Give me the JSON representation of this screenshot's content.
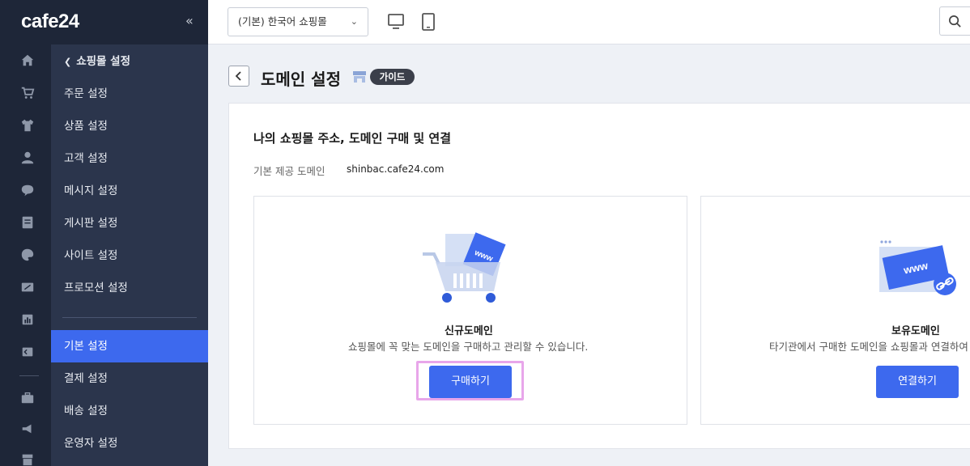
{
  "app": {
    "logo": "cafe24",
    "collapse_symbol": "«"
  },
  "rail_icons": [
    "home-icon",
    "cart-icon",
    "shirt-icon",
    "user-icon",
    "chat-icon",
    "board-icon",
    "palette-icon",
    "percent-icon",
    "stats-icon",
    "app-icon",
    "briefcase-icon",
    "megaphone-icon",
    "store-icon"
  ],
  "sidebar": {
    "back_label": "쇼핑몰 설정",
    "items": [
      {
        "label": "주문 설정"
      },
      {
        "label": "상품 설정"
      },
      {
        "label": "고객 설정"
      },
      {
        "label": "메시지 설정"
      },
      {
        "label": "게시판 설정"
      },
      {
        "label": "사이트 설정"
      },
      {
        "label": "프로모션 설정"
      }
    ],
    "items2": [
      {
        "label": "기본 설정",
        "active": true
      },
      {
        "label": "결제 설정"
      },
      {
        "label": "배송 설정"
      },
      {
        "label": "운영자 설정"
      }
    ]
  },
  "topbar": {
    "shop_select_value": "(기본) 한국어 쇼핑몰",
    "view_icons": [
      "desktop-icon",
      "mobile-icon"
    ]
  },
  "page": {
    "title": "도메인 설정",
    "guide_label": "가이드"
  },
  "content": {
    "section_title": "나의 쇼핑몰 주소, 도메인 구매 및 연결",
    "default_domain_label": "기본 제공 도메인",
    "default_domain_value": "shinbac.cafe24.com",
    "new_domain": {
      "illustration_text": "www",
      "title": "신규도메인",
      "desc": "쇼핑몰에 꼭 맞는 도메인을 구매하고 관리할 수 있습니다.",
      "button": "구매하기"
    },
    "own_domain": {
      "illustration_text": "www",
      "title": "보유도메인",
      "desc": "타기관에서 구매한 도메인을 쇼핑몰과 연결하여",
      "button": "연결하기"
    }
  },
  "colors": {
    "accent": "#3d69ee",
    "sidebar": "#2b354c",
    "rail": "#1e2638",
    "highlight": "#e8a6ea"
  }
}
